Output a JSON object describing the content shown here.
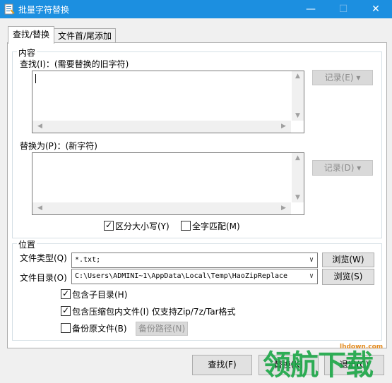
{
  "window": {
    "title": "批量字符替换",
    "minimize": "—",
    "maximize": "☐",
    "close": "✕",
    "accent": "#1c8fe0"
  },
  "tabs": [
    {
      "label": "查找/替换",
      "active": true
    },
    {
      "label": "文件首/尾添加",
      "active": false
    }
  ],
  "content_group": {
    "title": "内容",
    "find_label": "查找(I)：(需要替换的旧字符)",
    "find_value": "",
    "find_history": "记录(E)",
    "replace_label": "替换为(P)：(新字符)",
    "replace_value": "",
    "replace_history": "记录(D)",
    "case_sensitive": {
      "label": "区分大小写(Y)",
      "checked": true
    },
    "whole_word": {
      "label": "全字匹配(M)",
      "checked": false
    }
  },
  "location_group": {
    "title": "位置",
    "file_type_label": "文件类型(Q)",
    "file_type_value": "*.txt;",
    "browse1": "浏览(W)",
    "file_dir_label": "文件目录(O)",
    "file_dir_value": "C:\\Users\\ADMINI~1\\AppData\\Local\\Temp\\HaoZipReplace",
    "browse2": "浏览(S)",
    "subdirs": {
      "label": "包含子目录(H)",
      "checked": true
    },
    "archives": {
      "label": "包含压缩包内文件(I) 仅支持Zip/7z/Tar格式",
      "checked": true
    },
    "backup": {
      "label": "备份原文件(B)",
      "checked": false
    },
    "backup_path": "备份路径(N)"
  },
  "footer": {
    "find_button": "查找(F)",
    "replace_button": "替换(K)",
    "exit_button": "退出(C)"
  },
  "watermark": {
    "text": "领航下载",
    "url": "lhdown.com"
  }
}
